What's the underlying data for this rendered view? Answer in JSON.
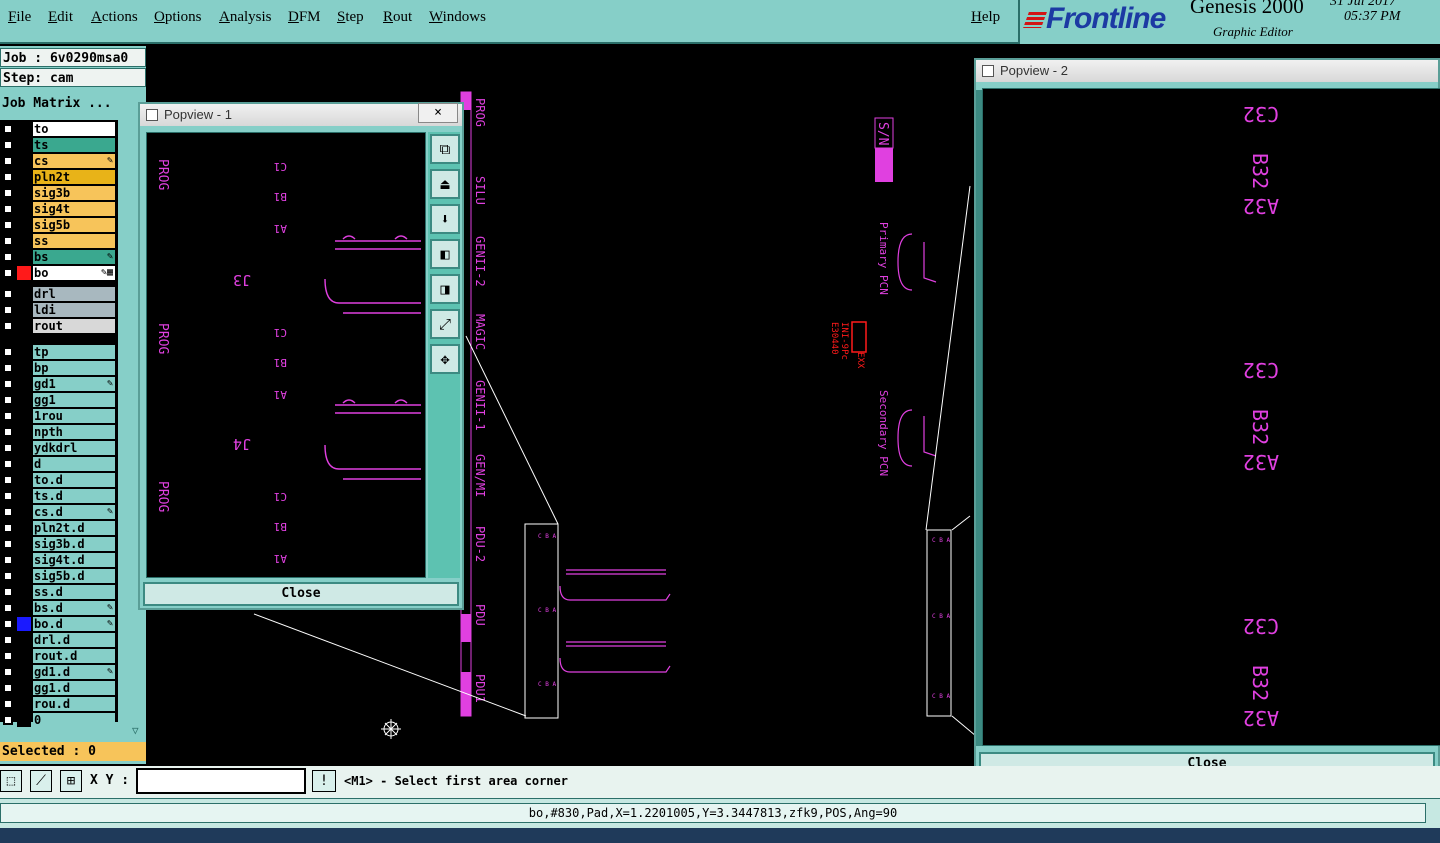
{
  "menubar": {
    "items": [
      "File",
      "Edit",
      "Actions",
      "Options",
      "Analysis",
      "DFM",
      "Step",
      "Rout",
      "Windows"
    ],
    "help": "Help"
  },
  "brand": {
    "logo": "Frontline",
    "product": "Genesis 2000",
    "subtitle": "Graphic Editor",
    "date": "31 Jul 2017",
    "time": "05:37 PM"
  },
  "job": {
    "job_label": "Job : 6v0290msa0",
    "step_label": "Step: cam",
    "matrix_button": "Job Matrix ..."
  },
  "colors": {
    "panel": "#86cfc8",
    "board": "#e040e0",
    "outline": "#ffffff",
    "highlight": "#ff1a1a",
    "selected_bar": "#f7c45a"
  },
  "layers": [
    {
      "name": "to",
      "color": "#ffffff",
      "swatch": "#000000",
      "mark": ""
    },
    {
      "name": "ts",
      "color": "#3aa88f",
      "swatch": "#000000",
      "mark": ""
    },
    {
      "name": "cs",
      "color": "#f7c45a",
      "swatch": "#000000",
      "mark": "✎"
    },
    {
      "name": "pln2t",
      "color": "#e8b318",
      "swatch": "#000000",
      "mark": ""
    },
    {
      "name": "sig3b",
      "color": "#f7c45a",
      "swatch": "#000000",
      "mark": ""
    },
    {
      "name": "sig4t",
      "color": "#f7c45a",
      "swatch": "#000000",
      "mark": ""
    },
    {
      "name": "sig5b",
      "color": "#f7c45a",
      "swatch": "#000000",
      "mark": ""
    },
    {
      "name": "ss",
      "color": "#f7c45a",
      "swatch": "#000000",
      "mark": ""
    },
    {
      "name": "bs",
      "color": "#3aa88f",
      "swatch": "#000000",
      "mark": "✎"
    },
    {
      "name": "bo",
      "color": "#ffffff",
      "swatch": "#ff1a1a",
      "mark": "✎▦"
    },
    {
      "name": "drl",
      "color": "#a8b8bf",
      "swatch": "#000000",
      "mark": ""
    },
    {
      "name": "ldi",
      "color": "#a8b8bf",
      "swatch": "#000000",
      "mark": ""
    },
    {
      "name": "rout",
      "color": "#d8d8d8",
      "swatch": "#000000",
      "mark": ""
    },
    {
      "name": "tp",
      "color": "#86cfc8",
      "swatch": "#000000",
      "mark": ""
    },
    {
      "name": "bp",
      "color": "#86cfc8",
      "swatch": "#000000",
      "mark": ""
    },
    {
      "name": "gd1",
      "color": "#86cfc8",
      "swatch": "#000000",
      "mark": "✎"
    },
    {
      "name": "gg1",
      "color": "#86cfc8",
      "swatch": "#000000",
      "mark": ""
    },
    {
      "name": "1rou",
      "color": "#86cfc8",
      "swatch": "#000000",
      "mark": ""
    },
    {
      "name": "npth",
      "color": "#86cfc8",
      "swatch": "#000000",
      "mark": ""
    },
    {
      "name": "ydkdrl",
      "color": "#86cfc8",
      "swatch": "#000000",
      "mark": ""
    },
    {
      "name": "d",
      "color": "#86cfc8",
      "swatch": "#000000",
      "mark": ""
    },
    {
      "name": "to.d",
      "color": "#86cfc8",
      "swatch": "#000000",
      "mark": ""
    },
    {
      "name": "ts.d",
      "color": "#86cfc8",
      "swatch": "#000000",
      "mark": ""
    },
    {
      "name": "cs.d",
      "color": "#86cfc8",
      "swatch": "#000000",
      "mark": "✎"
    },
    {
      "name": "pln2t.d",
      "color": "#86cfc8",
      "swatch": "#000000",
      "mark": ""
    },
    {
      "name": "sig3b.d",
      "color": "#86cfc8",
      "swatch": "#000000",
      "mark": ""
    },
    {
      "name": "sig4t.d",
      "color": "#86cfc8",
      "swatch": "#000000",
      "mark": ""
    },
    {
      "name": "sig5b.d",
      "color": "#86cfc8",
      "swatch": "#000000",
      "mark": ""
    },
    {
      "name": "ss.d",
      "color": "#86cfc8",
      "swatch": "#000000",
      "mark": ""
    },
    {
      "name": "bs.d",
      "color": "#86cfc8",
      "swatch": "#000000",
      "mark": "✎"
    },
    {
      "name": "bo.d",
      "color": "#86cfc8",
      "swatch": "#1a1aff",
      "mark": "✎"
    },
    {
      "name": "drl.d",
      "color": "#86cfc8",
      "swatch": "#000000",
      "mark": ""
    },
    {
      "name": "rout.d",
      "color": "#86cfc8",
      "swatch": "#000000",
      "mark": ""
    },
    {
      "name": "gd1.d",
      "color": "#86cfc8",
      "swatch": "#000000",
      "mark": "✎"
    },
    {
      "name": "gg1.d",
      "color": "#86cfc8",
      "swatch": "#000000",
      "mark": ""
    },
    {
      "name": "rou.d",
      "color": "#86cfc8",
      "swatch": "#000000",
      "mark": ""
    },
    {
      "name": "0",
      "color": "#86cfc8",
      "swatch": "#000000",
      "mark": ""
    }
  ],
  "selected_label": "Selected : 0",
  "canvas": {
    "edge_labels": [
      "PROG",
      "SILU",
      "GENII-2",
      "MAGIC",
      "GENII-1",
      "GEN/MI",
      "PDU-2",
      "PDU",
      "PDU1"
    ],
    "main_labels": [
      "S/N",
      "Primary PCN",
      "Secondary PCN"
    ],
    "highlight_labels": [
      "E30440",
      "INI-9Pc",
      "EXX"
    ],
    "cursor_icon": "crosshair"
  },
  "popview1": {
    "title": "Popview - 1",
    "close_x": "×",
    "close_button": "Close",
    "tools": [
      "zoom-home-icon",
      "layer-up-icon",
      "layer-down-icon",
      "pan-left-icon",
      "pan-right-icon",
      "zoom-fit-icon",
      "zoom-center-icon"
    ],
    "refdes": [
      "J3",
      "J4"
    ],
    "pins": [
      "C1",
      "B1",
      "A1",
      "C1",
      "B1",
      "A1",
      "C1",
      "B1",
      "A1"
    ],
    "side_labels": [
      "PROG",
      "PROG",
      "PROG"
    ]
  },
  "popview2": {
    "title": "Popview - 2",
    "close_button": "Close",
    "pins": [
      "C32",
      "B32",
      "A32",
      "C32",
      "B32",
      "A32",
      "C32",
      "B32",
      "A32"
    ]
  },
  "prompt": {
    "xy_label": "X Y :",
    "xy_value": "",
    "warn_icon": "!",
    "message": "<M1> - Select first area corner"
  },
  "status": "bo,#830,Pad,X=1.2201005,Y=3.3447813,zfk9,POS,Ang=90"
}
